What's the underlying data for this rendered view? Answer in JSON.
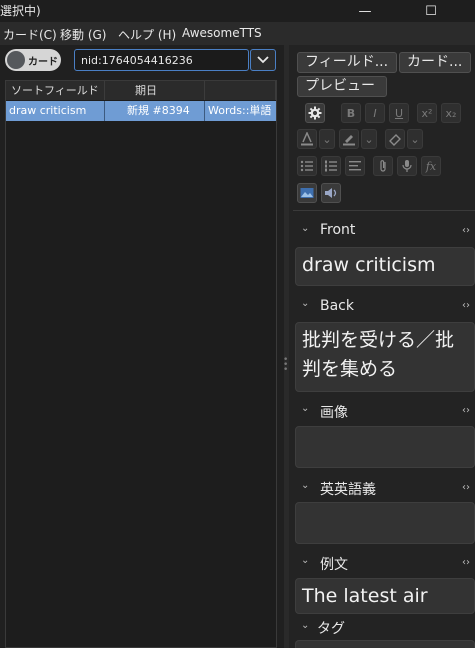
{
  "window": {
    "title": "選択中)",
    "btn_minimize": "—",
    "btn_maximize": "☐",
    "btn_close": "✕"
  },
  "menu": [
    "カード(C)",
    "移動 (G)",
    "ヘルプ (H)",
    "AwesomeTTS"
  ],
  "toggle": {
    "label": "カード",
    "state": "cards"
  },
  "search": {
    "value": "nid:1764054416236",
    "dropdown_icon": "chevron-down"
  },
  "table": {
    "columns": [
      "ソートフィールド",
      "期日",
      ""
    ],
    "rows": [
      {
        "sort_field": "draw criticism",
        "due": "新規 #8394",
        "tags": "Words::単語",
        "selected": true
      }
    ]
  },
  "editor_toolbar": {
    "buttons": [
      "フィールド...",
      "カード...",
      "プレビュー"
    ],
    "format": [
      "B",
      "I",
      "U",
      "x²",
      "x₂"
    ],
    "format_icons": [
      "settings",
      "bold",
      "italic",
      "underline",
      "superscript",
      "subscript",
      "text-color",
      "highlight",
      "eraser",
      "bullet-list",
      "numbered-list",
      "align",
      "attach",
      "record-audio",
      "math",
      "image-occlusion",
      "tts"
    ]
  },
  "fields": [
    {
      "name": "Front",
      "value": "draw criticism"
    },
    {
      "name": "Back",
      "value": "批判を受ける／批判を集める"
    },
    {
      "name": "画像",
      "value": ""
    },
    {
      "name": "英英語義",
      "value": ""
    },
    {
      "name": "例文",
      "value": "The latest air"
    },
    {
      "name": "タグ",
      "value": ""
    }
  ],
  "colors": {
    "selection": "#6f9cd4",
    "accent": "#4a7fc4",
    "background": "#2a2a2a",
    "editor_bg": "#333333"
  }
}
